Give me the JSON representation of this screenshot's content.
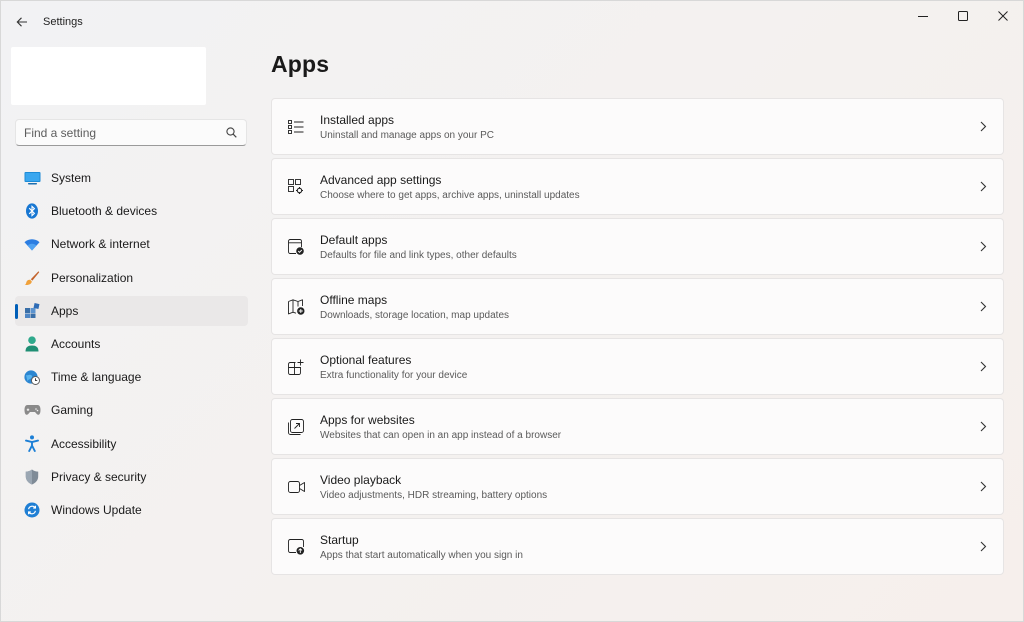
{
  "window": {
    "title": "Settings",
    "controls": {
      "minimize": "minimize-icon",
      "maximize": "maximize-icon",
      "close": "close-icon"
    }
  },
  "search": {
    "placeholder": "Find a setting",
    "value": ""
  },
  "sidebar": {
    "selected": "Apps",
    "accent_color": "#005fb8",
    "items": [
      {
        "label": "System",
        "icon": "system-icon"
      },
      {
        "label": "Bluetooth & devices",
        "icon": "bluetooth-icon"
      },
      {
        "label": "Network & internet",
        "icon": "wifi-icon"
      },
      {
        "label": "Personalization",
        "icon": "brush-icon"
      },
      {
        "label": "Apps",
        "icon": "apps-icon"
      },
      {
        "label": "Accounts",
        "icon": "person-icon"
      },
      {
        "label": "Time & language",
        "icon": "globe-clock-icon"
      },
      {
        "label": "Gaming",
        "icon": "gamepad-icon"
      },
      {
        "label": "Accessibility",
        "icon": "accessibility-icon"
      },
      {
        "label": "Privacy & security",
        "icon": "shield-icon"
      },
      {
        "label": "Windows Update",
        "icon": "update-icon"
      }
    ]
  },
  "main": {
    "title": "Apps",
    "cards": [
      {
        "title": "Installed apps",
        "subtitle": "Uninstall and manage apps on your PC",
        "icon": "list-icon"
      },
      {
        "title": "Advanced app settings",
        "subtitle": "Choose where to get apps, archive apps, uninstall updates",
        "icon": "app-settings-icon"
      },
      {
        "title": "Default apps",
        "subtitle": "Defaults for file and link types, other defaults",
        "icon": "default-apps-icon"
      },
      {
        "title": "Offline maps",
        "subtitle": "Downloads, storage location, map updates",
        "icon": "map-icon"
      },
      {
        "title": "Optional features",
        "subtitle": "Extra functionality for your device",
        "icon": "grid-add-icon"
      },
      {
        "title": "Apps for websites",
        "subtitle": "Websites that can open in an app instead of a browser",
        "icon": "open-link-icon"
      },
      {
        "title": "Video playback",
        "subtitle": "Video adjustments, HDR streaming, battery options",
        "icon": "video-icon"
      },
      {
        "title": "Startup",
        "subtitle": "Apps that start automatically when you sign in",
        "icon": "startup-icon"
      }
    ]
  }
}
